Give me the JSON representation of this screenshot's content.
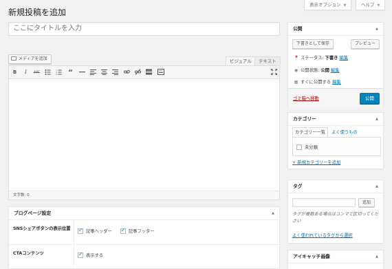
{
  "top": {
    "screen_options": "表示オプション",
    "help": "ヘルプ"
  },
  "page_title": "新規投稿を追加",
  "title_placeholder": "ここにタイトルを入力",
  "media_button": "メディアを追加",
  "editor_tabs": {
    "visual": "ビジュアル",
    "text": "テキスト"
  },
  "toolbar_icons": [
    "bold-icon",
    "italic-icon",
    "strikethrough-icon",
    "bullet-list-icon",
    "numbered-list-icon",
    "blockquote-icon",
    "horizontal-rule-icon",
    "align-left-icon",
    "align-center-icon",
    "align-right-icon",
    "link-icon",
    "unlink-icon",
    "read-more-icon",
    "toolbar-toggle-icon",
    "fullscreen-icon"
  ],
  "word_count": "文字数: 0",
  "publish": {
    "title": "公開",
    "save_draft": "下書きとして保存",
    "preview": "プレビュー",
    "status_label": "ステータス: ",
    "status_value": "下書き",
    "visibility_label": "公開状態: ",
    "visibility_value": "公開",
    "schedule_label": "すぐに公開する",
    "edit": "編集",
    "trash": "ゴミ箱へ移動",
    "publish_button": "公開"
  },
  "categories": {
    "title": "カテゴリー",
    "tab_all": "カテゴリー一覧",
    "tab_popular": "よく使うもの",
    "items": [
      "未分類"
    ],
    "add_new": "+ 新規カテゴリーを追加"
  },
  "tags": {
    "title": "タグ",
    "add_button": "追加",
    "hint": "タグが複数ある場合はコンマで区切ってください",
    "popular_link": "よく使われているタグから選択"
  },
  "featured_image": {
    "title": "アイキャッチ画像"
  },
  "blog_settings": {
    "title": "ブログページ設定",
    "sns_label": "SNSシェアボタンの表示位置",
    "sns_header": "記事ヘッダー",
    "sns_footer": "記事フッター",
    "cta_label": "CTAコンテンツ",
    "cta_show": "表示する"
  },
  "colors": {
    "link": "#0073aa",
    "primary": "#0085ba",
    "trash": "#a00"
  }
}
